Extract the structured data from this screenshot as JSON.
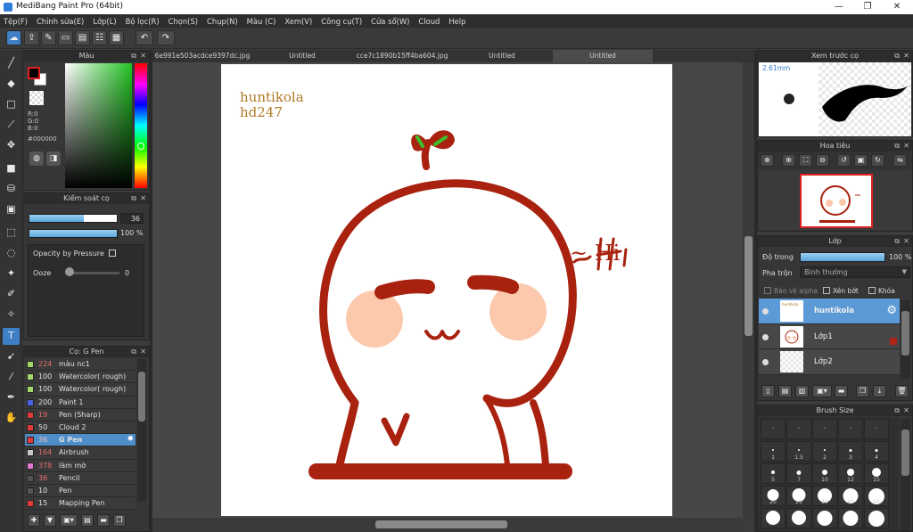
{
  "window": {
    "title": "MediBang Paint Pro (64bit)",
    "minimize": "—",
    "maximize": "❐",
    "close": "✕"
  },
  "menu": [
    "Tệp(F)",
    "Chỉnh sửa(E)",
    "Lớp(L)",
    "Bộ lọc(R)",
    "Chọn(S)",
    "Chụp(N)",
    "Màu (C)",
    "Xem(V)",
    "Công cụ(T)",
    "Cửa sổ(W)",
    "Cloud",
    "Help"
  ],
  "toolbar_icons": [
    "cloud-icon",
    "share-icon",
    "comment-icon",
    "message-icon",
    "document-icon",
    "table-icon",
    "grid-icon",
    "undo-icon",
    "redo-icon"
  ],
  "tools": [
    "brush-icon",
    "eraser-icon",
    "rectangle-icon",
    "line-icon",
    "move-icon",
    "fill-rect-icon",
    "bucket-icon",
    "gradient-icon",
    "select-rect-icon",
    "lasso-icon",
    "magic-wand-icon",
    "select-pen-icon",
    "select-eraser-icon",
    "text-icon",
    "operation-icon",
    "divide-icon",
    "eyedropper-icon",
    "hand-icon"
  ],
  "color_panel": {
    "title": "Màu",
    "foreground": "#000000",
    "r": "R:0",
    "g": "G:0",
    "b": "B:0",
    "hex": "#000000"
  },
  "brush_control": {
    "title": "Kiểm soát cọ",
    "size_value": "36",
    "size_fill": 0.62,
    "opacity_value": "100 %",
    "opacity_fill": 1.0,
    "opacity_by_pressure": "Opacity by Pressure",
    "ooze_label": "Ooze",
    "ooze_value": "0"
  },
  "brush_list": {
    "title": "Cọ: G Pen",
    "items": [
      {
        "size": "224",
        "name": "màu nc1",
        "color": "#a5d86a",
        "size_color": "#e86b6b"
      },
      {
        "size": "100",
        "name": "Watercolor( rough)",
        "color": "#a5d86a",
        "size_color": "#e0e0e0"
      },
      {
        "size": "100",
        "name": "Watercolor( rough)",
        "color": "#a5d86a",
        "size_color": "#e0e0e0"
      },
      {
        "size": "200",
        "name": "Paint 1",
        "color": "#4a62e0",
        "size_color": "#e0e0e0"
      },
      {
        "size": "19",
        "name": "Pen (Sharp)",
        "color": "#e03a3a",
        "size_color": "#e86b6b"
      },
      {
        "size": "50",
        "name": "Cloud 2",
        "color": "#e03a3a",
        "size_color": "#e0e0e0"
      },
      {
        "size": "36",
        "name": "G Pen",
        "color": "#e03a3a",
        "size_color": "#e86b6b",
        "selected": true
      },
      {
        "size": "164",
        "name": "Airbrush",
        "color": "#c8c8c8",
        "size_color": "#e86b6b"
      },
      {
        "size": "378",
        "name": "làm mờ",
        "color": "#e07ad0",
        "size_color": "#e86b6b"
      },
      {
        "size": "36",
        "name": "Pencil",
        "color": "#555555",
        "size_color": "#e86b6b"
      },
      {
        "size": "10",
        "name": "Pen",
        "color": "#555555",
        "size_color": "#e0e0e0"
      },
      {
        "size": "15",
        "name": "Mapping Pen",
        "color": "#e03a3a",
        "size_color": "#e0e0e0"
      }
    ]
  },
  "doc_tabs": [
    "6e991e503acdce9397dc.jpg",
    "Untitled",
    "cce7c1890b15ff4ba604.jpg",
    "Untitled",
    "Untitled"
  ],
  "canvas": {
    "line1": "huntikola",
    "line2": "hd247",
    "greeting": "~ Hi",
    "stroke_color": "#a8220f",
    "cheek_color": "#fcc9ac",
    "sprout_color": "#3bbf2c"
  },
  "preview": {
    "title": "Xem trước cọ",
    "size_text": "2.61mm"
  },
  "navigator": {
    "title": "Hoa tiêu",
    "tool_icons": [
      "zoom-in-icon",
      "zoom-in-alt-icon",
      "fit-icon",
      "zoom-out-icon",
      "rotate-left-icon",
      "fullscreen-icon",
      "rotate-right-icon",
      "flip-icon"
    ]
  },
  "layers": {
    "title": "Lớp",
    "opacity_label": "Độ trong",
    "opacity_value": "100 %",
    "blend_label": "Pha trộn",
    "blend_value": "Bình thường",
    "protect_alpha": "Bảo vệ alpha",
    "clipping": "Xén bớt",
    "lock": "Khóa",
    "items": [
      {
        "name": "huntikola",
        "selected": true
      },
      {
        "name": "Lớp1",
        "count": "8"
      },
      {
        "name": "Lớp2"
      }
    ]
  },
  "brush_size": {
    "title": "Brush Size",
    "cells": [
      {
        "label": "",
        "d": 1
      },
      {
        "label": "",
        "d": 1
      },
      {
        "label": "",
        "d": 1
      },
      {
        "label": "",
        "d": 1
      },
      {
        "label": "",
        "d": 1
      },
      {
        "label": "1",
        "d": 2
      },
      {
        "label": "1.5",
        "d": 2
      },
      {
        "label": "2",
        "d": 2
      },
      {
        "label": "3",
        "d": 3
      },
      {
        "label": "4",
        "d": 3
      },
      {
        "label": "5",
        "d": 4
      },
      {
        "label": "7",
        "d": 5
      },
      {
        "label": "10",
        "d": 6
      },
      {
        "label": "12",
        "d": 8
      },
      {
        "label": "15",
        "d": 10
      },
      {
        "label": "20",
        "d": 13
      },
      {
        "label": "25",
        "d": 15
      },
      {
        "label": "30",
        "d": 16
      },
      {
        "label": "40",
        "d": 17
      },
      {
        "label": "50",
        "d": 18
      },
      {
        "label": "",
        "d": 16
      },
      {
        "label": "",
        "d": 16
      },
      {
        "label": "",
        "d": 17
      },
      {
        "label": "",
        "d": 17
      },
      {
        "label": "",
        "d": 18
      }
    ]
  }
}
